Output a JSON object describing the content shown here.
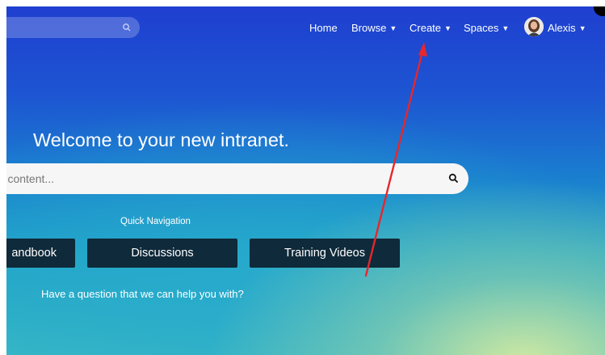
{
  "nav": {
    "home_label": "Home",
    "browse_label": "Browse",
    "create_label": "Create",
    "spaces_label": "Spaces",
    "user_label": "Alexis"
  },
  "hero": {
    "title": "Welcome to your new intranet.",
    "search_placeholder": "nd content...",
    "quick_nav_label": "Quick Navigation",
    "buttons": [
      "andbook",
      "Discussions",
      "Training Videos"
    ],
    "help_text": "Have a question that we can help you with?"
  },
  "annotation": {
    "arrow_color": "#e8262b"
  },
  "icons": {
    "search": "search-icon",
    "dropdown": "caret-down-icon",
    "user": "avatar"
  }
}
